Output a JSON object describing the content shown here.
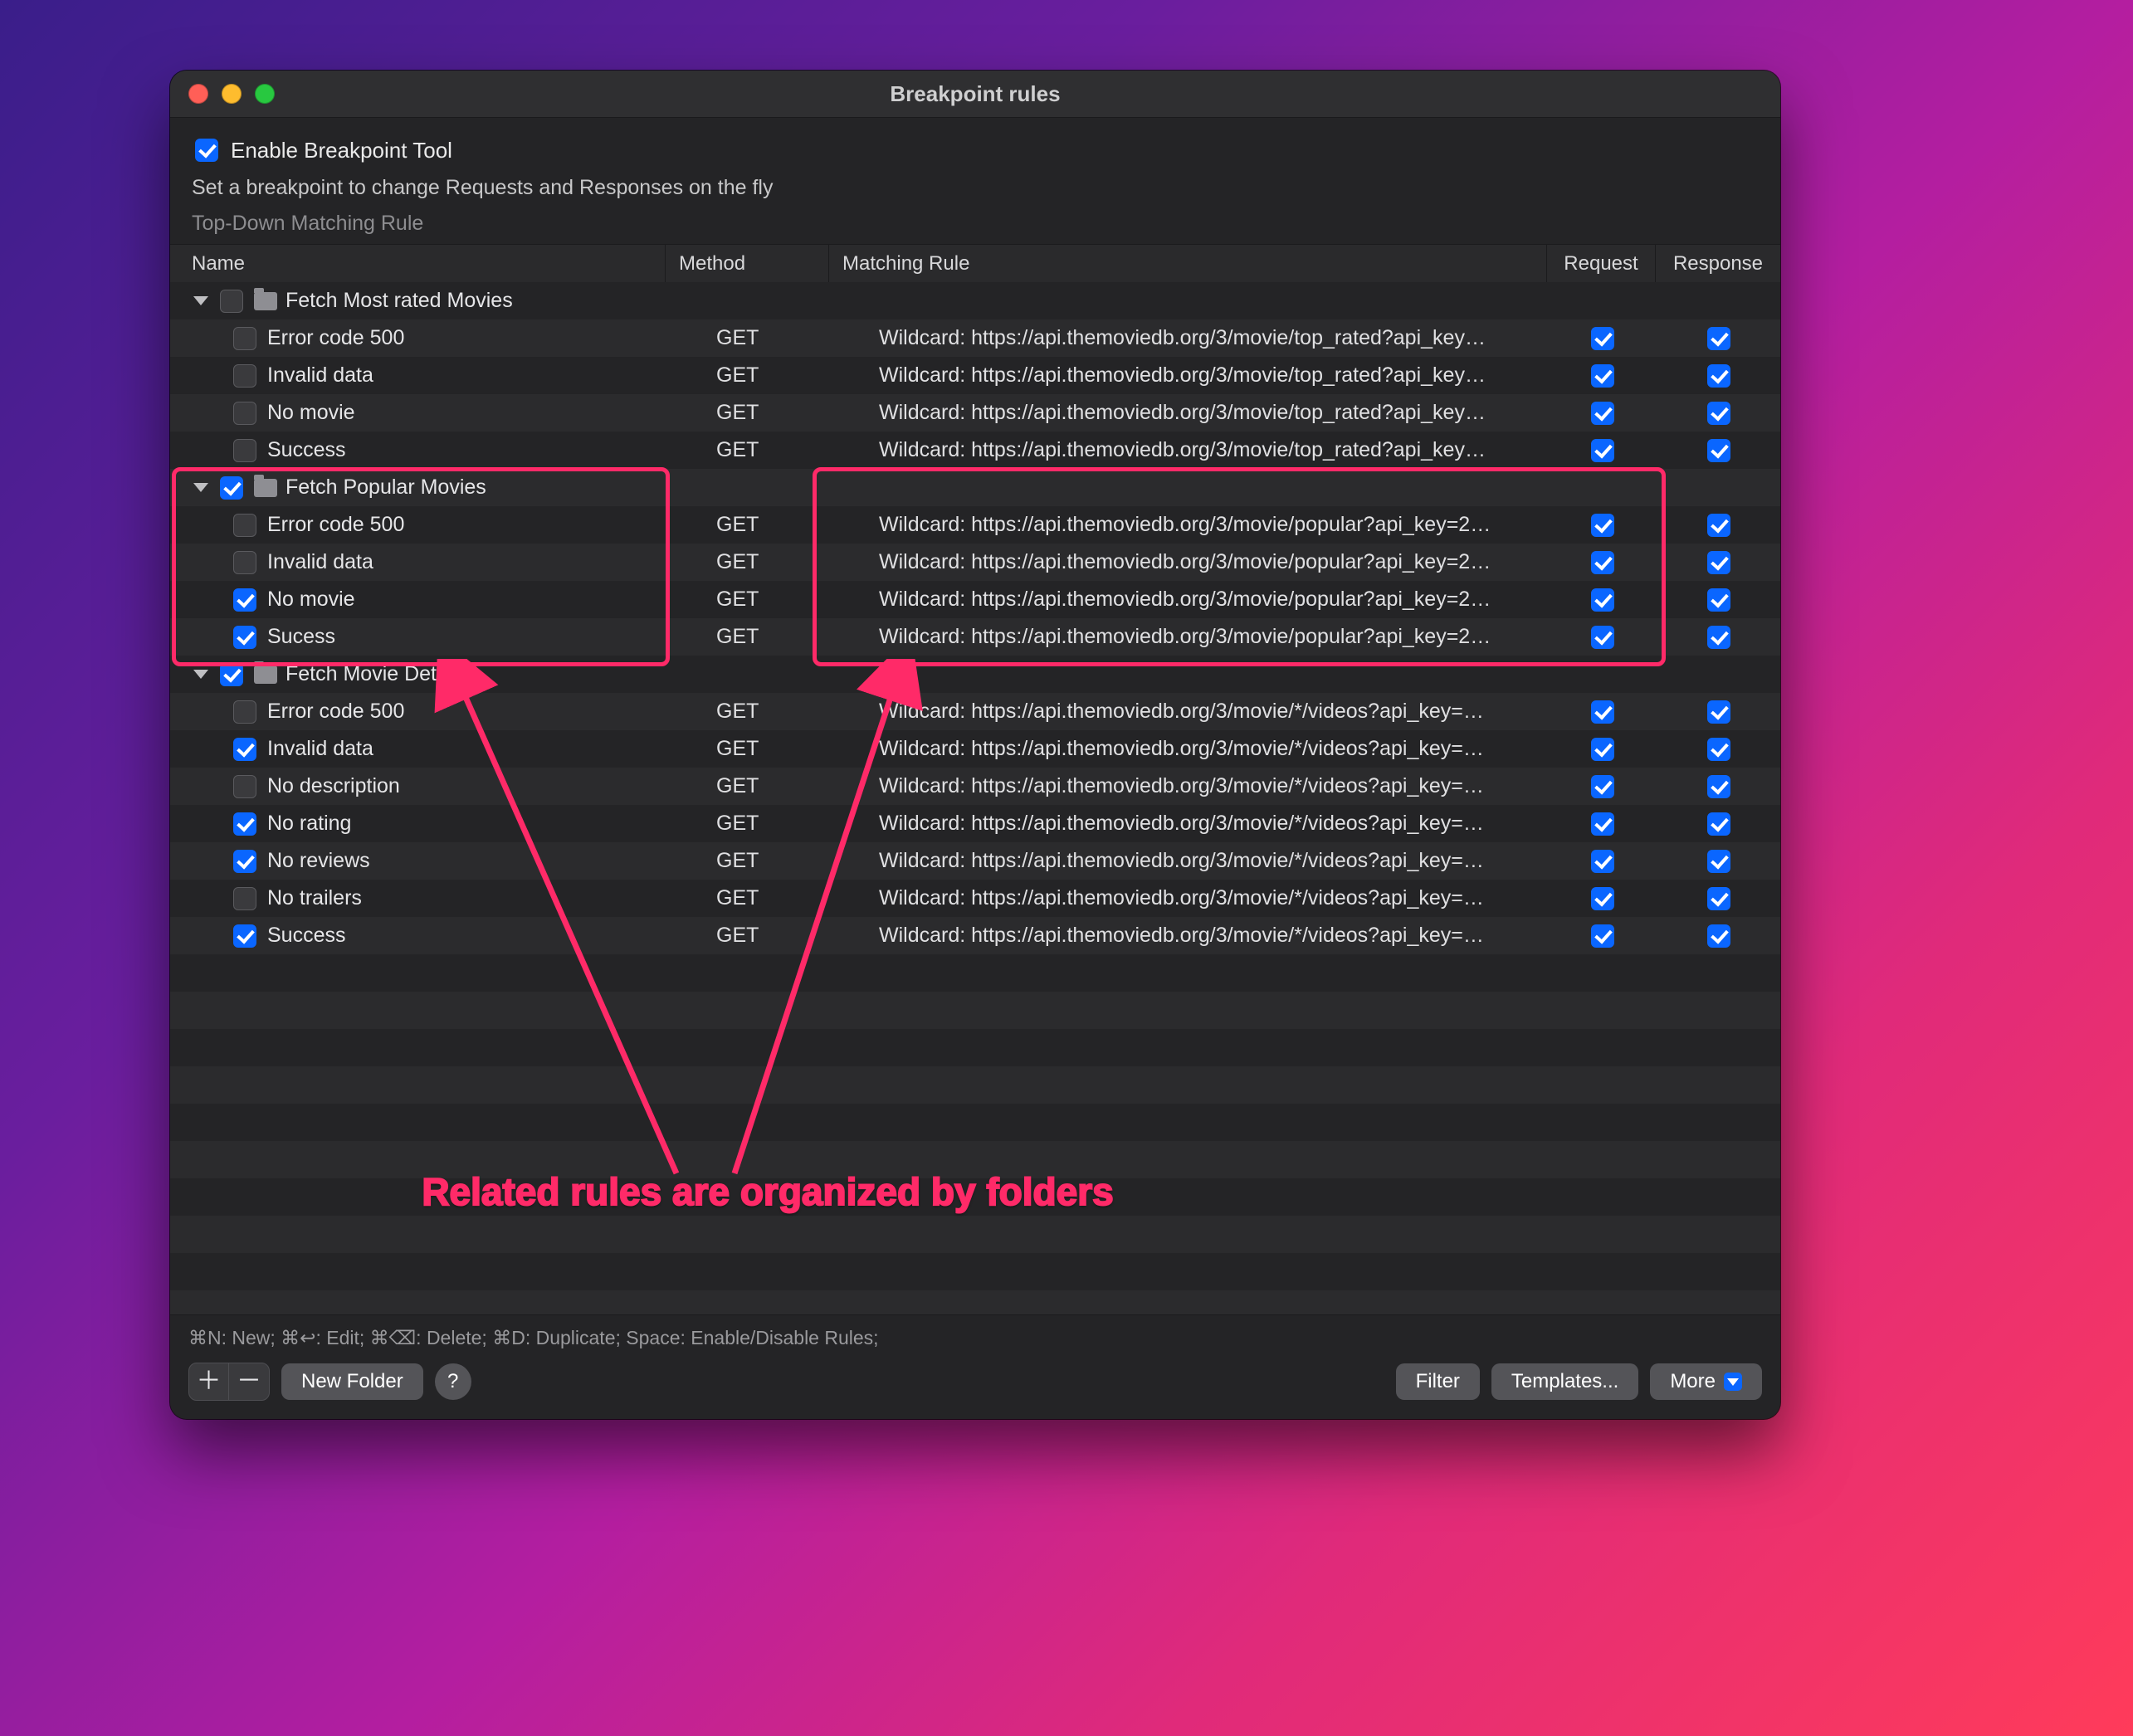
{
  "window": {
    "title": "Breakpoint rules",
    "enableLabel": "Enable Breakpoint Tool",
    "enableChecked": true,
    "subtitle": "Set a breakpoint to change Requests and Responses on the fly",
    "matchMode": "Top-Down Matching Rule"
  },
  "columns": {
    "name": "Name",
    "method": "Method",
    "rule": "Matching Rule",
    "request": "Request",
    "response": "Response"
  },
  "groups": [
    {
      "name": "Fetch Most rated Movies",
      "checked": false,
      "highlighted": false,
      "rules": [
        {
          "name": "Error code 500",
          "checked": false,
          "method": "GET",
          "rule": "Wildcard: https://api.themoviedb.org/3/movie/top_rated?api_key…",
          "req": true,
          "res": true
        },
        {
          "name": "Invalid data",
          "checked": false,
          "method": "GET",
          "rule": "Wildcard: https://api.themoviedb.org/3/movie/top_rated?api_key…",
          "req": true,
          "res": true
        },
        {
          "name": "No movie",
          "checked": false,
          "method": "GET",
          "rule": "Wildcard: https://api.themoviedb.org/3/movie/top_rated?api_key…",
          "req": true,
          "res": true
        },
        {
          "name": "Success",
          "checked": false,
          "method": "GET",
          "rule": "Wildcard: https://api.themoviedb.org/3/movie/top_rated?api_key…",
          "req": true,
          "res": true
        }
      ]
    },
    {
      "name": "Fetch Popular Movies",
      "checked": true,
      "highlighted": true,
      "rules": [
        {
          "name": "Error code 500",
          "checked": false,
          "method": "GET",
          "rule": "Wildcard: https://api.themoviedb.org/3/movie/popular?api_key=2…",
          "req": true,
          "res": true
        },
        {
          "name": "Invalid data",
          "checked": false,
          "method": "GET",
          "rule": "Wildcard: https://api.themoviedb.org/3/movie/popular?api_key=2…",
          "req": true,
          "res": true
        },
        {
          "name": "No movie",
          "checked": true,
          "method": "GET",
          "rule": "Wildcard: https://api.themoviedb.org/3/movie/popular?api_key=2…",
          "req": true,
          "res": true
        },
        {
          "name": "Sucess",
          "checked": true,
          "method": "GET",
          "rule": "Wildcard: https://api.themoviedb.org/3/movie/popular?api_key=2…",
          "req": true,
          "res": true
        }
      ]
    },
    {
      "name": "Fetch Movie Detail",
      "checked": true,
      "highlighted": false,
      "rules": [
        {
          "name": "Error code 500",
          "checked": false,
          "method": "GET",
          "rule": "Wildcard: https://api.themoviedb.org/3/movie/*/videos?api_key=…",
          "req": true,
          "res": true
        },
        {
          "name": "Invalid data",
          "checked": true,
          "method": "GET",
          "rule": "Wildcard: https://api.themoviedb.org/3/movie/*/videos?api_key=…",
          "req": true,
          "res": true
        },
        {
          "name": "No description",
          "checked": false,
          "method": "GET",
          "rule": "Wildcard: https://api.themoviedb.org/3/movie/*/videos?api_key=…",
          "req": true,
          "res": true
        },
        {
          "name": "No rating",
          "checked": true,
          "method": "GET",
          "rule": "Wildcard: https://api.themoviedb.org/3/movie/*/videos?api_key=…",
          "req": true,
          "res": true
        },
        {
          "name": "No reviews",
          "checked": true,
          "method": "GET",
          "rule": "Wildcard: https://api.themoviedb.org/3/movie/*/videos?api_key=…",
          "req": true,
          "res": true
        },
        {
          "name": "No trailers",
          "checked": false,
          "method": "GET",
          "rule": "Wildcard: https://api.themoviedb.org/3/movie/*/videos?api_key=…",
          "req": true,
          "res": true
        },
        {
          "name": "Success",
          "checked": true,
          "method": "GET",
          "rule": "Wildcard: https://api.themoviedb.org/3/movie/*/videos?api_key=…",
          "req": true,
          "res": true
        }
      ]
    }
  ],
  "footer": {
    "hint": "⌘N: New; ⌘↩: Edit; ⌘⌫: Delete; ⌘D: Duplicate; Space: Enable/Disable Rules;",
    "newFolder": "New Folder",
    "help": "?",
    "filter": "Filter",
    "templates": "Templates...",
    "more": "More"
  },
  "annotation": {
    "caption": "Related rules are organized by folders"
  }
}
